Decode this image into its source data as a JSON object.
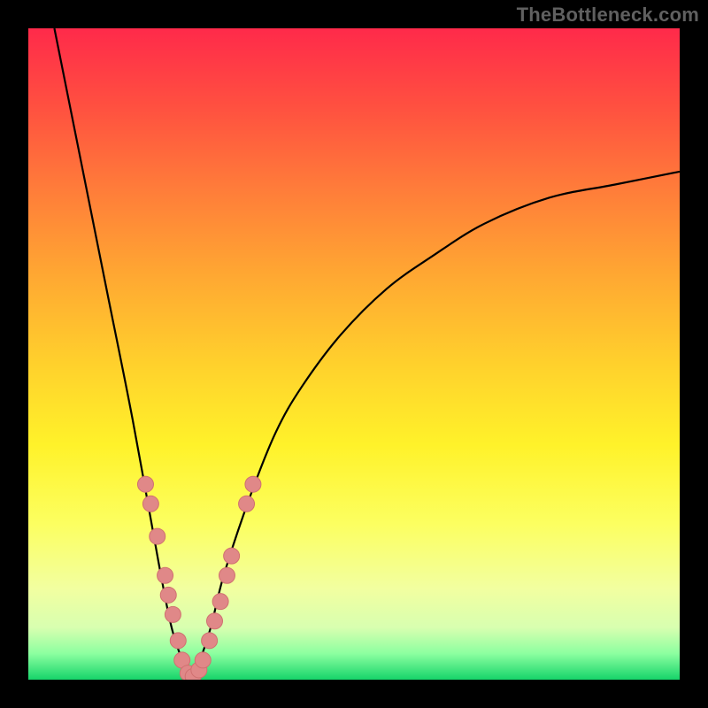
{
  "watermark": {
    "text": "TheBottleneck.com"
  },
  "colors": {
    "frame": "#000000",
    "curve": "#000000",
    "marker_fill": "#e08888",
    "marker_stroke": "#d07070",
    "gradient_stops": [
      "#ff2a4a",
      "#ff5040",
      "#ff7a3a",
      "#ffa832",
      "#ffd22c",
      "#fff22a",
      "#fcff60",
      "#f2ffa0",
      "#d8ffb0",
      "#8cffa0",
      "#16d46a"
    ]
  },
  "chart_data": {
    "type": "line",
    "title": "",
    "xlabel": "",
    "ylabel": "",
    "xlim": [
      0,
      100
    ],
    "ylim": [
      0,
      100
    ],
    "grid": false,
    "legend": false,
    "note": "V-shaped bottleneck curve; minimum (optimal) around x≈25. Left branch steep, right branch asymptotic toward ~78.",
    "series": [
      {
        "name": "bottleneck",
        "x": [
          4,
          8,
          12,
          16,
          20,
          22,
          24,
          25,
          26,
          28,
          30,
          34,
          38,
          42,
          48,
          55,
          62,
          70,
          80,
          90,
          100
        ],
        "y": [
          100,
          80,
          60,
          40,
          18,
          8,
          2,
          0,
          2,
          8,
          16,
          28,
          38,
          45,
          53,
          60,
          65,
          70,
          74,
          76,
          78
        ]
      }
    ],
    "markers": {
      "name": "salmon-dots",
      "note": "Clustered near the minimum of the V; a few slightly higher on each branch.",
      "points": [
        {
          "x": 18.0,
          "y": 30
        },
        {
          "x": 18.8,
          "y": 27
        },
        {
          "x": 19.8,
          "y": 22
        },
        {
          "x": 21.0,
          "y": 16
        },
        {
          "x": 21.5,
          "y": 13
        },
        {
          "x": 22.2,
          "y": 10
        },
        {
          "x": 23.0,
          "y": 6
        },
        {
          "x": 23.6,
          "y": 3
        },
        {
          "x": 24.5,
          "y": 1
        },
        {
          "x": 25.3,
          "y": 0.5
        },
        {
          "x": 26.2,
          "y": 1.5
        },
        {
          "x": 26.8,
          "y": 3
        },
        {
          "x": 27.8,
          "y": 6
        },
        {
          "x": 28.6,
          "y": 9
        },
        {
          "x": 29.5,
          "y": 12
        },
        {
          "x": 30.5,
          "y": 16
        },
        {
          "x": 31.2,
          "y": 19
        },
        {
          "x": 33.5,
          "y": 27
        },
        {
          "x": 34.5,
          "y": 30
        }
      ]
    }
  }
}
